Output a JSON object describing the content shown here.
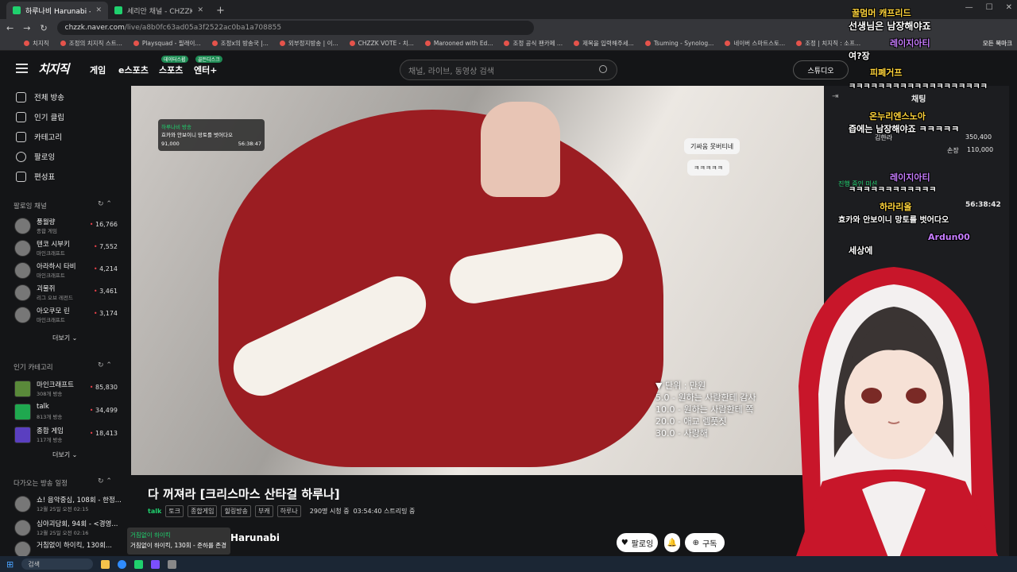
{
  "browser": {
    "tabs": [
      {
        "title": "하루나비 Harunabi - 다 꺼져라"
      },
      {
        "title": "세리안 채널 - CHZZK"
      }
    ],
    "new_tab": "+",
    "url_host": "chzzk.naver.com",
    "url_path": "/live/a8b0fc63ad05a3f2522ac0ba1a708855",
    "bookmarks": [
      "치지직",
      "조정의 치지직 스트...",
      "Playsquad - 필래이...",
      "조정x의 방송국 |...",
      "외부정지방송 | 이...",
      "CHZZK VOTE - 치...",
      "Marooned with Ed...",
      "조정 공식 팬카페 ...",
      "제목을 입력해주세...",
      "Tsuming - Synolog...",
      "네이버 스마트스토...",
      "조정 | 치지직 : 소프..."
    ],
    "all_bookmarks": "모든 북마크"
  },
  "header": {
    "logo": "치지직",
    "nav": [
      {
        "label": "게임"
      },
      {
        "label": "e스포츠"
      },
      {
        "label": "스포츠",
        "badge": "데이터스윕"
      },
      {
        "label": "엔터+",
        "badge": "골든디스크"
      }
    ],
    "search_placeholder": "채널, 라이브, 동영상 검색",
    "studio": "스튜디오"
  },
  "sidebar": {
    "menu": [
      "전체 방송",
      "인기 클립",
      "카테고리",
      "팔로잉",
      "편성표"
    ],
    "following_title": "팔로잉 채널",
    "following": [
      {
        "name": "풍월량",
        "sub": "종합 게임",
        "viewers": "16,766"
      },
      {
        "name": "텐코 시부키",
        "sub": "마인크래프트",
        "viewers": "7,552"
      },
      {
        "name": "아라하시 타비",
        "sub": "마인크래프트",
        "viewers": "4,214"
      },
      {
        "name": "괴물쥐",
        "sub": "리그 오브 레전드",
        "viewers": "3,461"
      },
      {
        "name": "아오쿠모 린",
        "sub": "마인크래프트",
        "viewers": "3,174"
      }
    ],
    "more1": "더보기",
    "popular_title": "인기 카테고리",
    "categories": [
      {
        "name": "마인크래프트",
        "sub": "308개 방송",
        "viewers": "85,830"
      },
      {
        "name": "talk",
        "sub": "813개 방송",
        "viewers": "34,499"
      },
      {
        "name": "종합 게임",
        "sub": "117개 방송",
        "viewers": "18,413"
      }
    ],
    "more2": "더보기",
    "upcoming_title": "다가오는 방송 일정",
    "upcoming": [
      {
        "name": "쇼! 음악중심, 108회 - 한정...",
        "sub": "12월 25일 오전 02:15"
      },
      {
        "name": "심야괴담회, 94회 - <경영...",
        "sub": "12월 25일 오전 02:16"
      },
      {
        "name": "거침없이 하이킥, 130회...",
        "sub": ""
      }
    ]
  },
  "player": {
    "popup_title": "하루나비 방송",
    "popup_text": "효카와 안보이니 망토를 벗어다오",
    "popup_count": "91,000",
    "popup_time": "56:38:47",
    "bubble1": "기싸움 못버티네",
    "bubble2": "ㅋㅋㅋㅋㅋ",
    "rules": [
      "▼ 단위 : 만원",
      "5.0 - 원하는 사람한테 감사",
      "10.0 - 원하는 사람한테 쪽",
      "20.0 - 애교 렘풋짓",
      "30.0 - 사랑해"
    ]
  },
  "stream": {
    "title": "다 꺼져라 [크리스마스 산타걸 하루나]",
    "category": "talk",
    "tags": [
      "토크",
      "종합게임",
      "힐링방송",
      "부캐",
      "하루나"
    ],
    "viewers": "290명 시청 중",
    "uptime": "03:54:40 스트리밍 중",
    "channel": "Harunabi",
    "follow": "팔로잉",
    "subscribe": "구독"
  },
  "tooltip": {
    "name": "거침없이 하이킥",
    "text": "거침없이 하이킥, 130회 - 준하를 존경"
  },
  "chat": {
    "header": "채팅",
    "ranking": [
      {
        "name": "김한라",
        "value": "350,400"
      },
      {
        "name": "손장",
        "value": "110,000"
      }
    ],
    "overlay": [
      {
        "nick": "꿀멈머 캐프리드",
        "msg": "선생님은 남장해야죠"
      },
      {
        "nick": "레이지아티",
        "msg": "여?장"
      },
      {
        "nick": "피폐거프",
        "msg": "ㅋㅋㅋㅋㅋㅋㅋㅋㅋㅋㅋㅋㅋㅋㅋㅋㅋㅋㅋ"
      },
      {
        "nick": "온누리엔스노아",
        "msg": "즙에는 남장해야죠 ㅋㅋㅋㅋㅋ"
      },
      {
        "nick": "레이지아티",
        "msg": "ㅋㅋㅋㅋㅋㅋㅋㅋㅋㅋㅋㅋ"
      },
      {
        "nick": "하라리올",
        "msg": "효카와 안보이니 망토를 벗어다오"
      },
      {
        "nick": "Ardun00",
        "msg": "세상에"
      }
    ],
    "pinned_time": "56:38:42",
    "pinned_label": "진행 중인 미션"
  },
  "taskbar": {
    "search": "검색"
  },
  "colors": {
    "brand": "#1fd16e",
    "bg": "#141517",
    "live": "#e9414a"
  }
}
